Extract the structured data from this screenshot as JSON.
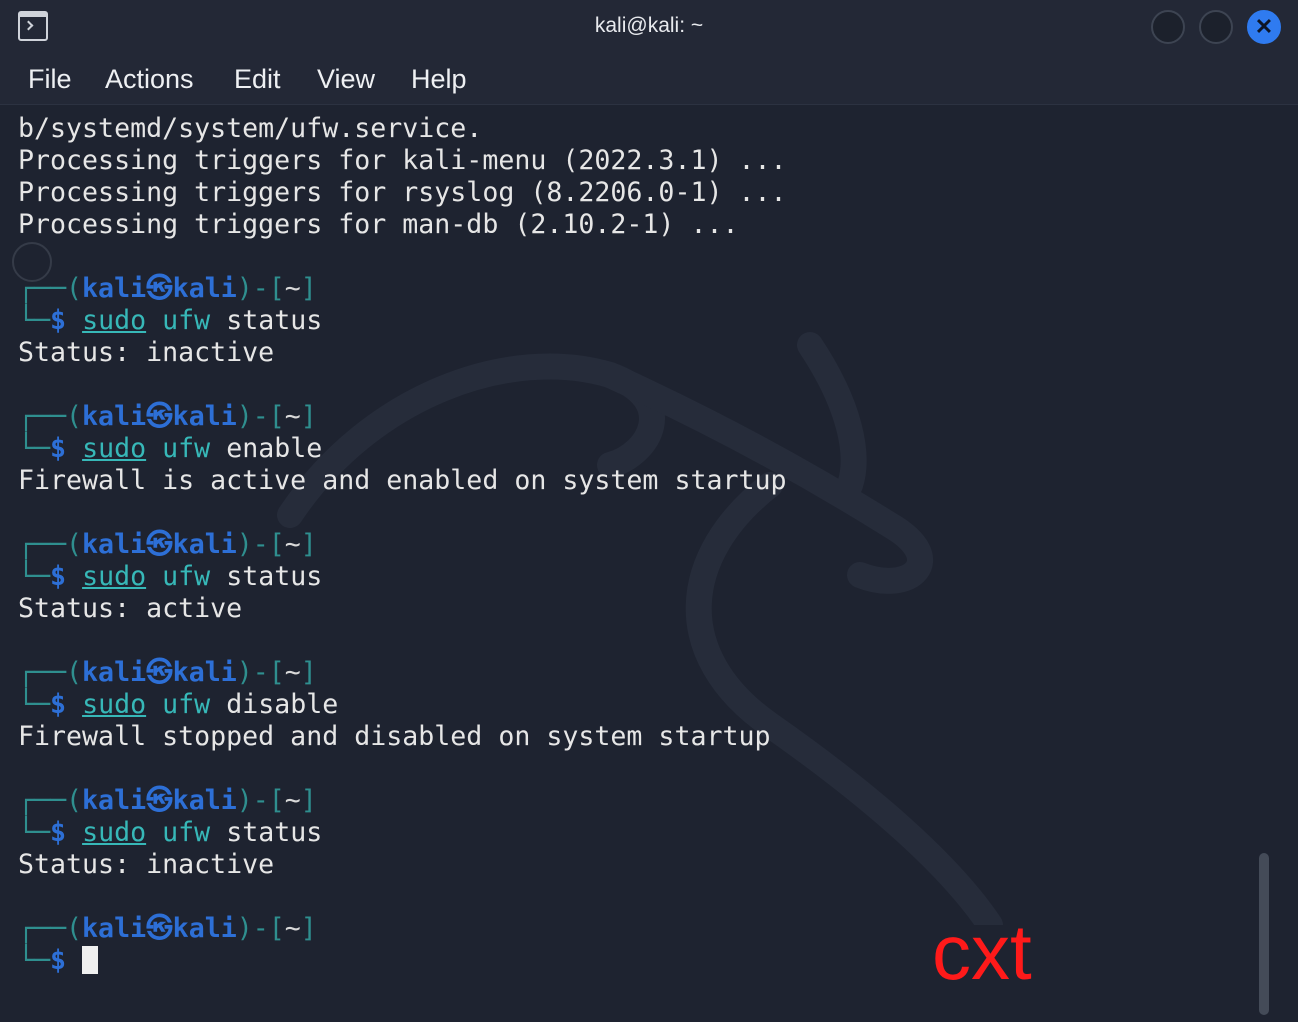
{
  "window": {
    "title": "kali@kali: ~",
    "close_glyph": "✕"
  },
  "menu": {
    "file": "File",
    "actions": "Actions",
    "edit": "Edit",
    "view": "View",
    "help": "Help"
  },
  "terminal": {
    "output_top": [
      "b/systemd/system/ufw.service.",
      "Processing triggers for kali-menu (2022.3.1) ...",
      "Processing triggers for rsyslog (8.2206.0-1) ...",
      "Processing triggers for man-db (2.10.2-1) ..."
    ],
    "prompt": {
      "frame_top": "┌──(",
      "user": "kali㉿kali",
      "frame_mid": ")-[",
      "cwd": "~",
      "frame_end": "]",
      "frame_bottom": "└─",
      "dollar": "$"
    },
    "sudo_word": "sudo",
    "cmd_word": "ufw",
    "blocks": [
      {
        "arg": "status",
        "output": "Status: inactive"
      },
      {
        "arg": "enable",
        "output": "Firewall is active and enabled on system startup"
      },
      {
        "arg": "status",
        "output": "Status: active"
      },
      {
        "arg": "disable",
        "output": "Firewall stopped and disabled on system startup"
      },
      {
        "arg": "status",
        "output": "Status: inactive"
      }
    ]
  },
  "watermark": "cxt",
  "colors": {
    "background": "#1e2330",
    "prompt_user": "#2d6fd6",
    "prompt_frame": "#2f8f8f",
    "command": "#37b8b8",
    "watermark": "#ff1a1a",
    "close_button": "#2f7bf0"
  }
}
